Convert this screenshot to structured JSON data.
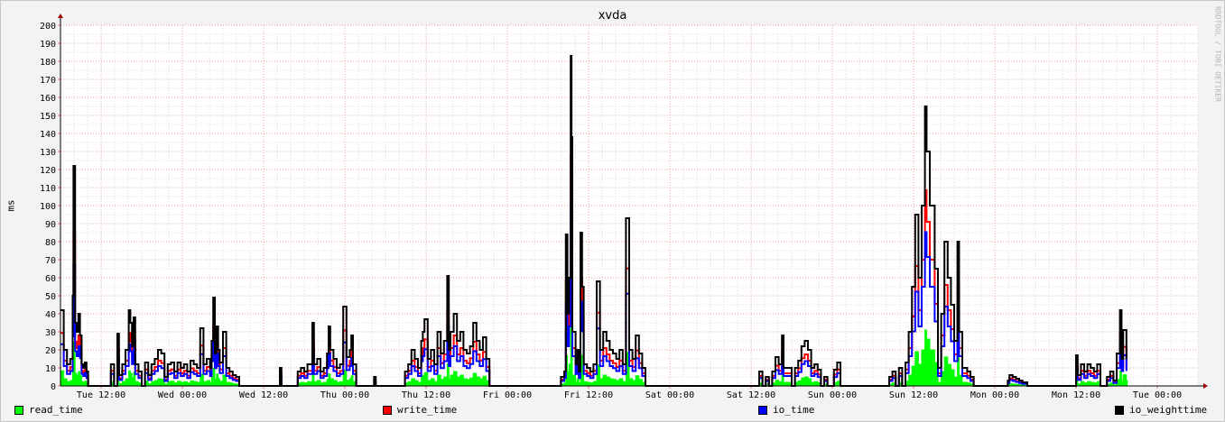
{
  "chart_data": {
    "type": "area",
    "title": "xvda",
    "ylabel": "ms",
    "watermark": "RRDTOOL / TOBI OETIKER",
    "ylim": [
      0,
      200
    ],
    "yticks": [
      0,
      10,
      20,
      30,
      40,
      50,
      60,
      70,
      80,
      90,
      100,
      110,
      120,
      130,
      140,
      150,
      160,
      170,
      180,
      190,
      200
    ],
    "xlim": [
      0,
      7.0
    ],
    "x_unit": "days from Tue 06:00",
    "xticks": [
      {
        "label": "Tue 12:00",
        "x": 0.25
      },
      {
        "label": "Wed 00:00",
        "x": 0.75
      },
      {
        "label": "Wed 12:00",
        "x": 1.25
      },
      {
        "label": "Thu 00:00",
        "x": 1.75
      },
      {
        "label": "Thu 12:00",
        "x": 2.25
      },
      {
        "label": "Fri 00:00",
        "x": 2.75
      },
      {
        "label": "Fri 12:00",
        "x": 3.25
      },
      {
        "label": "Sat 00:00",
        "x": 3.75
      },
      {
        "label": "Sat 12:00",
        "x": 4.25
      },
      {
        "label": "Sun 00:00",
        "x": 4.75
      },
      {
        "label": "Sun 12:00",
        "x": 5.25
      },
      {
        "label": "Mon 00:00",
        "x": 5.75
      },
      {
        "label": "Mon 12:00",
        "x": 6.25
      },
      {
        "label": "Tue 00:00",
        "x": 6.75
      }
    ],
    "legend": "bottom",
    "series": [
      {
        "name": "read_time",
        "color": "#00ff00"
      },
      {
        "name": "write_time",
        "color": "#ff0000"
      },
      {
        "name": "io_time",
        "color": "#0000ff"
      },
      {
        "name": "io_weighttime",
        "color": "#000000"
      }
    ],
    "io_weighttime_points": [
      [
        0.0,
        42
      ],
      [
        0.02,
        20
      ],
      [
        0.04,
        12
      ],
      [
        0.06,
        15
      ],
      [
        0.075,
        50
      ],
      [
        0.08,
        122
      ],
      [
        0.09,
        35
      ],
      [
        0.1,
        30
      ],
      [
        0.11,
        40
      ],
      [
        0.12,
        28
      ],
      [
        0.13,
        12
      ],
      [
        0.14,
        10
      ],
      [
        0.15,
        13
      ],
      [
        0.16,
        8
      ],
      [
        0.17,
        0
      ],
      [
        0.3,
        0
      ],
      [
        0.31,
        12
      ],
      [
        0.33,
        0
      ],
      [
        0.35,
        29
      ],
      [
        0.36,
        6
      ],
      [
        0.38,
        12
      ],
      [
        0.4,
        20
      ],
      [
        0.42,
        42
      ],
      [
        0.43,
        35
      ],
      [
        0.44,
        22
      ],
      [
        0.45,
        38
      ],
      [
        0.46,
        12
      ],
      [
        0.48,
        8
      ],
      [
        0.5,
        0
      ],
      [
        0.52,
        13
      ],
      [
        0.54,
        6
      ],
      [
        0.56,
        12
      ],
      [
        0.58,
        15
      ],
      [
        0.6,
        20
      ],
      [
        0.62,
        18
      ],
      [
        0.64,
        5
      ],
      [
        0.66,
        12
      ],
      [
        0.68,
        13
      ],
      [
        0.7,
        8
      ],
      [
        0.72,
        13
      ],
      [
        0.74,
        10
      ],
      [
        0.76,
        12
      ],
      [
        0.78,
        8
      ],
      [
        0.8,
        14
      ],
      [
        0.82,
        12
      ],
      [
        0.84,
        10
      ],
      [
        0.86,
        32
      ],
      [
        0.88,
        12
      ],
      [
        0.9,
        15
      ],
      [
        0.92,
        10
      ],
      [
        0.93,
        25
      ],
      [
        0.94,
        49
      ],
      [
        0.95,
        18
      ],
      [
        0.96,
        33
      ],
      [
        0.97,
        20
      ],
      [
        0.98,
        13
      ],
      [
        1.0,
        30
      ],
      [
        1.02,
        10
      ],
      [
        1.04,
        8
      ],
      [
        1.06,
        6
      ],
      [
        1.08,
        5
      ],
      [
        1.1,
        0
      ],
      [
        1.15,
        0
      ],
      [
        1.2,
        0
      ],
      [
        1.3,
        0
      ],
      [
        1.34,
        0
      ],
      [
        1.35,
        10
      ],
      [
        1.36,
        0
      ],
      [
        1.45,
        0
      ],
      [
        1.46,
        8
      ],
      [
        1.48,
        10
      ],
      [
        1.5,
        8
      ],
      [
        1.52,
        12
      ],
      [
        1.55,
        35
      ],
      [
        1.56,
        12
      ],
      [
        1.58,
        15
      ],
      [
        1.6,
        8
      ],
      [
        1.62,
        10
      ],
      [
        1.64,
        18
      ],
      [
        1.65,
        33
      ],
      [
        1.66,
        20
      ],
      [
        1.68,
        15
      ],
      [
        1.7,
        10
      ],
      [
        1.72,
        12
      ],
      [
        1.74,
        44
      ],
      [
        1.76,
        16
      ],
      [
        1.78,
        20
      ],
      [
        1.79,
        28
      ],
      [
        1.8,
        12
      ],
      [
        1.82,
        0
      ],
      [
        1.85,
        0
      ],
      [
        1.9,
        0
      ],
      [
        1.93,
        5
      ],
      [
        1.94,
        0
      ],
      [
        2.0,
        0
      ],
      [
        2.05,
        0
      ],
      [
        2.1,
        0
      ],
      [
        2.12,
        8
      ],
      [
        2.14,
        12
      ],
      [
        2.16,
        20
      ],
      [
        2.18,
        15
      ],
      [
        2.2,
        10
      ],
      [
        2.22,
        25
      ],
      [
        2.23,
        30
      ],
      [
        2.24,
        37
      ],
      [
        2.26,
        15
      ],
      [
        2.28,
        20
      ],
      [
        2.3,
        12
      ],
      [
        2.32,
        30
      ],
      [
        2.34,
        18
      ],
      [
        2.36,
        25
      ],
      [
        2.38,
        61
      ],
      [
        2.39,
        20
      ],
      [
        2.4,
        30
      ],
      [
        2.42,
        40
      ],
      [
        2.44,
        25
      ],
      [
        2.46,
        30
      ],
      [
        2.48,
        20
      ],
      [
        2.5,
        18
      ],
      [
        2.52,
        22
      ],
      [
        2.54,
        35
      ],
      [
        2.56,
        25
      ],
      [
        2.58,
        20
      ],
      [
        2.6,
        27
      ],
      [
        2.62,
        15
      ],
      [
        2.64,
        0
      ],
      [
        2.7,
        0
      ],
      [
        2.8,
        0
      ],
      [
        2.9,
        0
      ],
      [
        2.95,
        0
      ],
      [
        3.0,
        0
      ],
      [
        3.07,
        0
      ],
      [
        3.08,
        5
      ],
      [
        3.1,
        8
      ],
      [
        3.11,
        84
      ],
      [
        3.12,
        40
      ],
      [
        3.13,
        60
      ],
      [
        3.14,
        183
      ],
      [
        3.145,
        138
      ],
      [
        3.15,
        30
      ],
      [
        3.17,
        12
      ],
      [
        3.18,
        20
      ],
      [
        3.19,
        8
      ],
      [
        3.2,
        85
      ],
      [
        3.21,
        55
      ],
      [
        3.22,
        12
      ],
      [
        3.24,
        10
      ],
      [
        3.26,
        8
      ],
      [
        3.28,
        12
      ],
      [
        3.3,
        58
      ],
      [
        3.32,
        20
      ],
      [
        3.34,
        30
      ],
      [
        3.36,
        25
      ],
      [
        3.38,
        20
      ],
      [
        3.4,
        18
      ],
      [
        3.42,
        15
      ],
      [
        3.44,
        20
      ],
      [
        3.46,
        12
      ],
      [
        3.48,
        93
      ],
      [
        3.5,
        20
      ],
      [
        3.52,
        15
      ],
      [
        3.54,
        28
      ],
      [
        3.56,
        18
      ],
      [
        3.58,
        10
      ],
      [
        3.6,
        0
      ],
      [
        3.7,
        0
      ],
      [
        3.9,
        0
      ],
      [
        4.0,
        0
      ],
      [
        4.1,
        0
      ],
      [
        4.2,
        0
      ],
      [
        4.29,
        0
      ],
      [
        4.3,
        8
      ],
      [
        4.32,
        0
      ],
      [
        4.34,
        5
      ],
      [
        4.36,
        0
      ],
      [
        4.38,
        8
      ],
      [
        4.4,
        16
      ],
      [
        4.42,
        12
      ],
      [
        4.44,
        28
      ],
      [
        4.45,
        10
      ],
      [
        4.5,
        0
      ],
      [
        4.52,
        10
      ],
      [
        4.54,
        14
      ],
      [
        4.56,
        22
      ],
      [
        4.58,
        25
      ],
      [
        4.6,
        20
      ],
      [
        4.62,
        10
      ],
      [
        4.64,
        12
      ],
      [
        4.66,
        9
      ],
      [
        4.68,
        0
      ],
      [
        4.7,
        5
      ],
      [
        4.72,
        0
      ],
      [
        4.76,
        9
      ],
      [
        4.78,
        13
      ],
      [
        4.8,
        0
      ],
      [
        4.9,
        0
      ],
      [
        5.0,
        0
      ],
      [
        5.05,
        0
      ],
      [
        5.1,
        5
      ],
      [
        5.12,
        8
      ],
      [
        5.14,
        0
      ],
      [
        5.16,
        10
      ],
      [
        5.18,
        0
      ],
      [
        5.2,
        13
      ],
      [
        5.22,
        30
      ],
      [
        5.24,
        55
      ],
      [
        5.26,
        95
      ],
      [
        5.28,
        60
      ],
      [
        5.3,
        100
      ],
      [
        5.32,
        155
      ],
      [
        5.33,
        130
      ],
      [
        5.35,
        100
      ],
      [
        5.38,
        65
      ],
      [
        5.4,
        10
      ],
      [
        5.42,
        40
      ],
      [
        5.44,
        80
      ],
      [
        5.46,
        60
      ],
      [
        5.48,
        45
      ],
      [
        5.5,
        25
      ],
      [
        5.52,
        80
      ],
      [
        5.53,
        30
      ],
      [
        5.55,
        10
      ],
      [
        5.58,
        8
      ],
      [
        5.6,
        5
      ],
      [
        5.62,
        0
      ],
      [
        5.7,
        0
      ],
      [
        5.8,
        0
      ],
      [
        5.83,
        3
      ],
      [
        5.84,
        6
      ],
      [
        5.86,
        5
      ],
      [
        5.88,
        4
      ],
      [
        5.9,
        3
      ],
      [
        5.92,
        2
      ],
      [
        5.95,
        0
      ],
      [
        6.0,
        0
      ],
      [
        6.05,
        0
      ],
      [
        6.1,
        0
      ],
      [
        6.15,
        0
      ],
      [
        6.2,
        0
      ],
      [
        6.24,
        0
      ],
      [
        6.25,
        17
      ],
      [
        6.26,
        6
      ],
      [
        6.28,
        12
      ],
      [
        6.3,
        8
      ],
      [
        6.32,
        12
      ],
      [
        6.34,
        10
      ],
      [
        6.36,
        8
      ],
      [
        6.38,
        12
      ],
      [
        6.4,
        0
      ],
      [
        6.44,
        5
      ],
      [
        6.46,
        8
      ],
      [
        6.48,
        3
      ],
      [
        6.5,
        18
      ],
      [
        6.52,
        42
      ],
      [
        6.53,
        15
      ],
      [
        6.54,
        31
      ],
      [
        6.56,
        15
      ]
    ]
  },
  "legend_items": [
    {
      "label": "read_time",
      "color": "#00ff00"
    },
    {
      "label": "write_time",
      "color": "#ff0000"
    },
    {
      "label": "io_time",
      "color": "#0000ff"
    },
    {
      "label": "io_weighttime",
      "color": "#000000"
    }
  ]
}
